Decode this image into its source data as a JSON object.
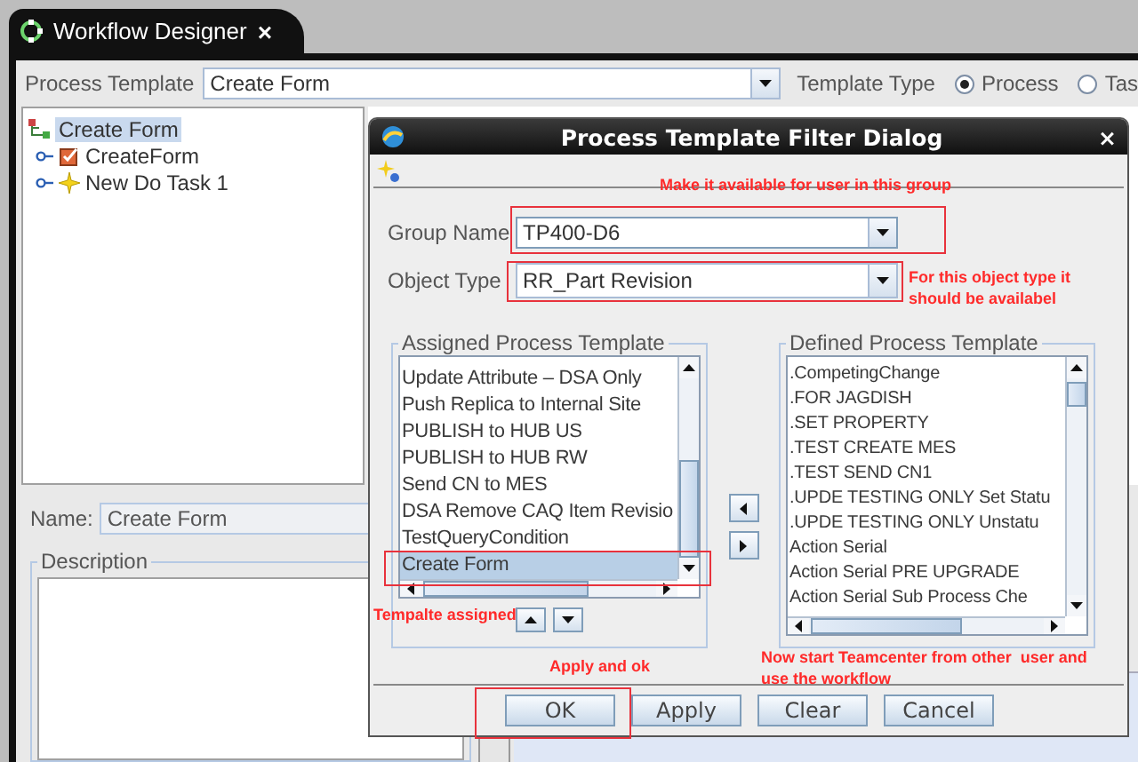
{
  "tab": {
    "title": "Workflow Designer",
    "close": "×"
  },
  "toolbar": {
    "template_label": "Process Template",
    "template_value": "Create Form",
    "type_label": "Template Type",
    "type_options": [
      {
        "label": "Process",
        "selected": true
      },
      {
        "label": "Tas",
        "selected": false
      }
    ]
  },
  "tree": {
    "label": "Create Form",
    "selected": true,
    "children": [
      {
        "label": "CreateForm",
        "kind": "form",
        "selected": false
      },
      {
        "label": "New Do Task 1",
        "kind": "task",
        "selected": false
      }
    ]
  },
  "details": {
    "name_label": "Name:",
    "name_value": "Create Form",
    "description_label": "Description"
  },
  "dialog": {
    "title": "Process Template Filter Dialog",
    "close": "×",
    "group": {
      "label": "Group Name",
      "value": "TP400-D6",
      "highlighted": true
    },
    "object": {
      "label": "Object Type",
      "value": "RR_Part Revision",
      "highlighted": true
    },
    "assigned": {
      "title": "Assigned Process Template",
      "items": [
        {
          "label": "Update Attribute – DSA Only",
          "selected": false,
          "highlighted": false
        },
        {
          "label": "Push Replica to Internal Site",
          "selected": false,
          "highlighted": false
        },
        {
          "label": "PUBLISH to HUB US",
          "selected": false,
          "highlighted": false
        },
        {
          "label": "PUBLISH to HUB RW",
          "selected": false,
          "highlighted": false
        },
        {
          "label": "Send CN to MES",
          "selected": false,
          "highlighted": false
        },
        {
          "label": "DSA Remove CAQ Item Revisio",
          "selected": false,
          "highlighted": false
        },
        {
          "label": "TestQueryCondition",
          "selected": false,
          "highlighted": false
        },
        {
          "label": "Create Form",
          "selected": true,
          "highlighted": true
        }
      ]
    },
    "defined": {
      "title": "Defined Process Template",
      "items": [
        {
          "label": ".CompetingChange",
          "selected": false
        },
        {
          "label": ".FOR JAGDISH",
          "selected": false
        },
        {
          "label": ".SET PROPERTY",
          "selected": false
        },
        {
          "label": ".TEST CREATE MES",
          "selected": false
        },
        {
          "label": ".TEST SEND CN1",
          "selected": false
        },
        {
          "label": ".UPDE TESTING ONLY Set Statu",
          "selected": false
        },
        {
          "label": ".UPDE TESTING ONLY Unstatu",
          "selected": false
        },
        {
          "label": "Action Serial",
          "selected": false
        },
        {
          "label": "Action Serial PRE UPGRADE",
          "selected": false
        },
        {
          "label": "Action Serial Sub Process Che",
          "selected": false
        }
      ]
    },
    "buttons": [
      {
        "label": "OK",
        "highlighted": true
      },
      {
        "label": "Apply",
        "highlighted": false
      },
      {
        "label": "Clear",
        "highlighted": false
      },
      {
        "label": "Cancel",
        "highlighted": false
      }
    ]
  },
  "annotations": {
    "group_note": "Make it available for user in this group",
    "object_note": "For this object type it should be availabel",
    "assigned_note": "Tempalte assigned",
    "apply_note": "Apply and ok",
    "start_note": "Now start Teamcenter from other  user and use the workflow"
  }
}
